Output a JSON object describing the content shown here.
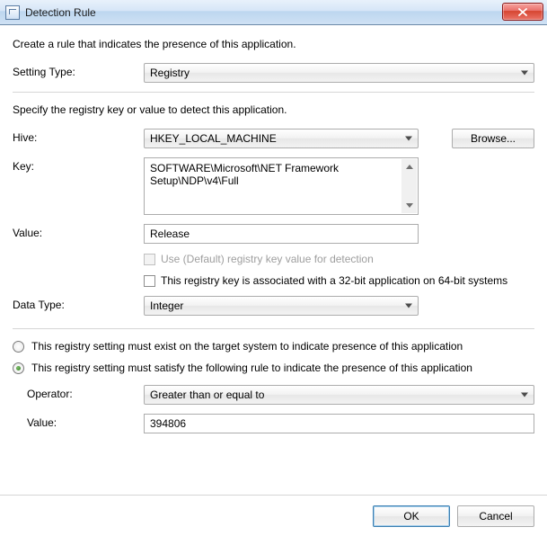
{
  "window": {
    "title": "Detection Rule"
  },
  "intro": "Create a rule that indicates the presence of this application.",
  "settingType": {
    "label": "Setting Type:",
    "value": "Registry"
  },
  "section2": {
    "desc": "Specify the registry key or value to detect this application.",
    "hive": {
      "label": "Hive:",
      "value": "HKEY_LOCAL_MACHINE",
      "browse": "Browse..."
    },
    "key": {
      "label": "Key:",
      "value": "SOFTWARE\\Microsoft\\NET Framework Setup\\NDP\\v4\\Full"
    },
    "value": {
      "label": "Value:",
      "value": "Release"
    },
    "useDefault": "Use (Default) registry key value for detection",
    "assoc32": "This registry key is associated with a 32-bit application on 64-bit systems",
    "dataType": {
      "label": "Data Type:",
      "value": "Integer"
    }
  },
  "radios": {
    "exist": "This registry setting must exist on the target system to indicate presence of this application",
    "satisfy": "This registry setting must satisfy the following rule to indicate the presence of this application"
  },
  "rule": {
    "operator": {
      "label": "Operator:",
      "value": "Greater than or equal to"
    },
    "value": {
      "label": "Value:",
      "value": "394806"
    }
  },
  "footer": {
    "ok": "OK",
    "cancel": "Cancel"
  }
}
